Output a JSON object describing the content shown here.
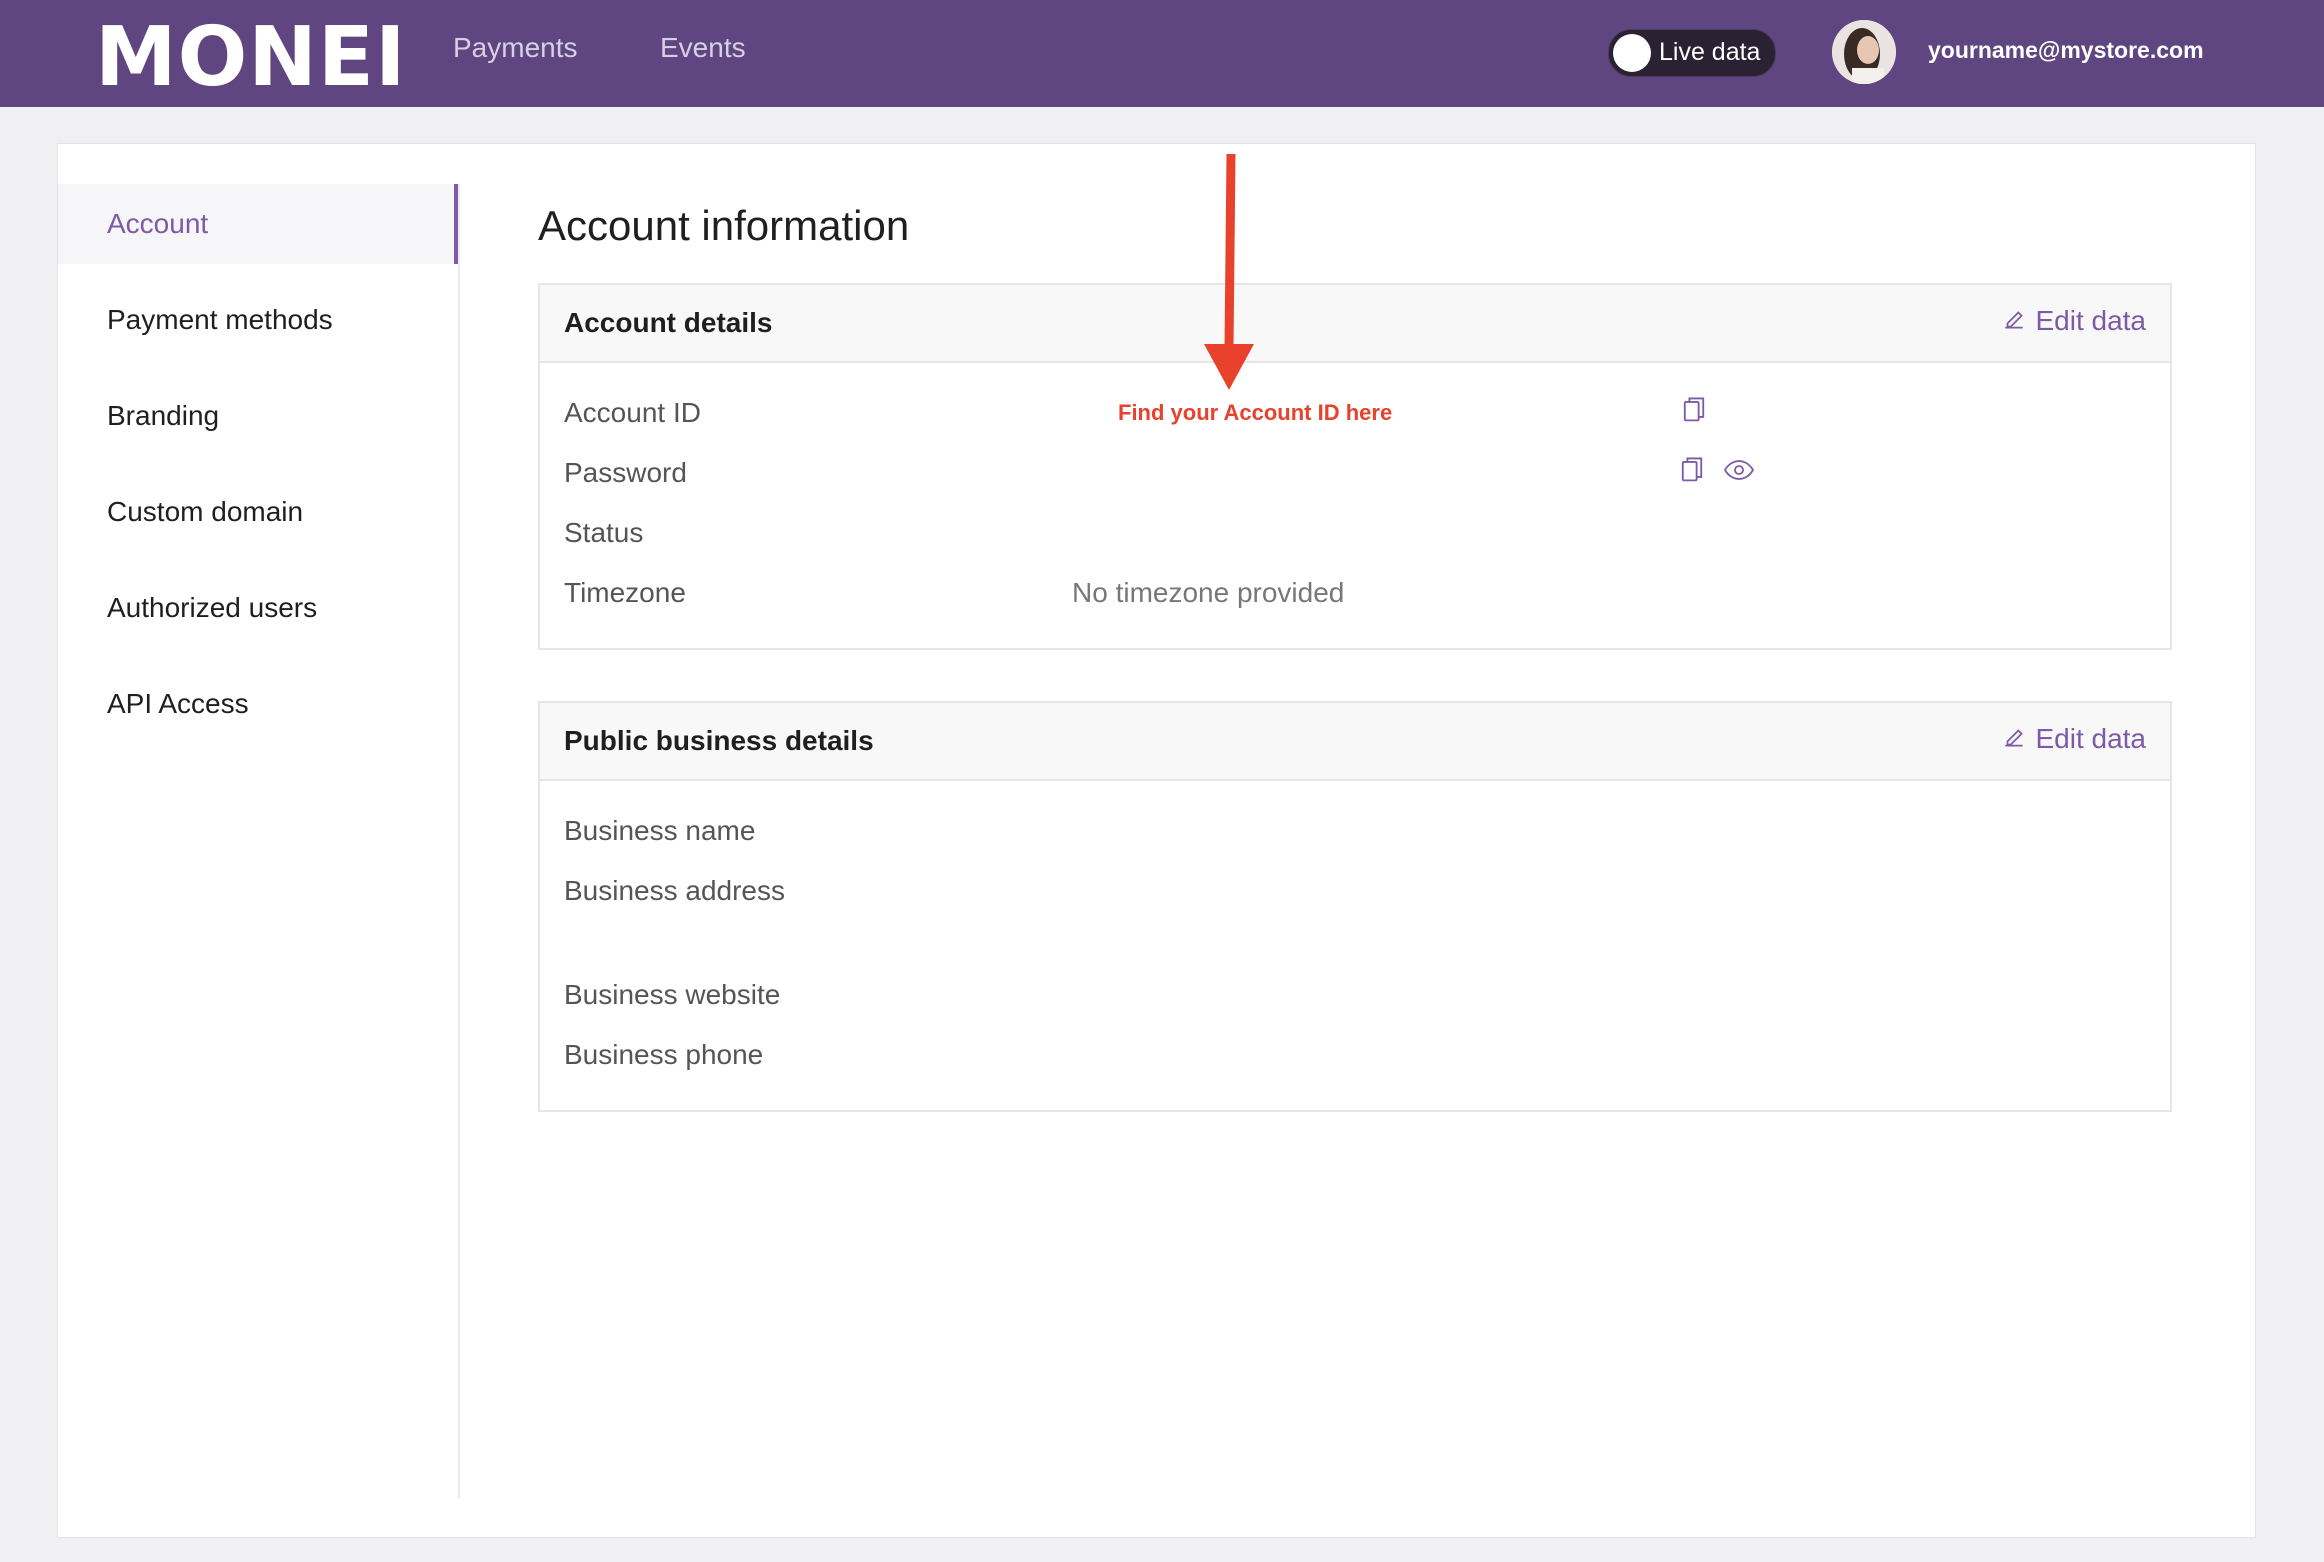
{
  "header": {
    "logo": "MONEI",
    "nav": [
      "Payments",
      "Events"
    ],
    "live_label": "Live data",
    "user_email": "yourname@mystore.com"
  },
  "sidebar": {
    "items": [
      "Account",
      "Payment methods",
      "Branding",
      "Custom domain",
      "Authorized users",
      "API Access"
    ],
    "active": "Account"
  },
  "main": {
    "title": "Account information",
    "account_details": {
      "title": "Account details",
      "edit_label": "Edit data",
      "fields": {
        "account_id": "Account ID",
        "password": "Password",
        "status": "Status",
        "timezone": "Timezone",
        "timezone_value": "No timezone provided"
      }
    },
    "public_details": {
      "title": "Public business details",
      "edit_label": "Edit data",
      "fields": {
        "name": "Business name",
        "address": "Business address",
        "website": "Business website",
        "phone": "Business phone"
      }
    },
    "annotation": "Find your Account ID here"
  },
  "colors": {
    "header_bg": "#5f4680",
    "accent": "#7e5aa6",
    "annotation": "#e8412c"
  }
}
